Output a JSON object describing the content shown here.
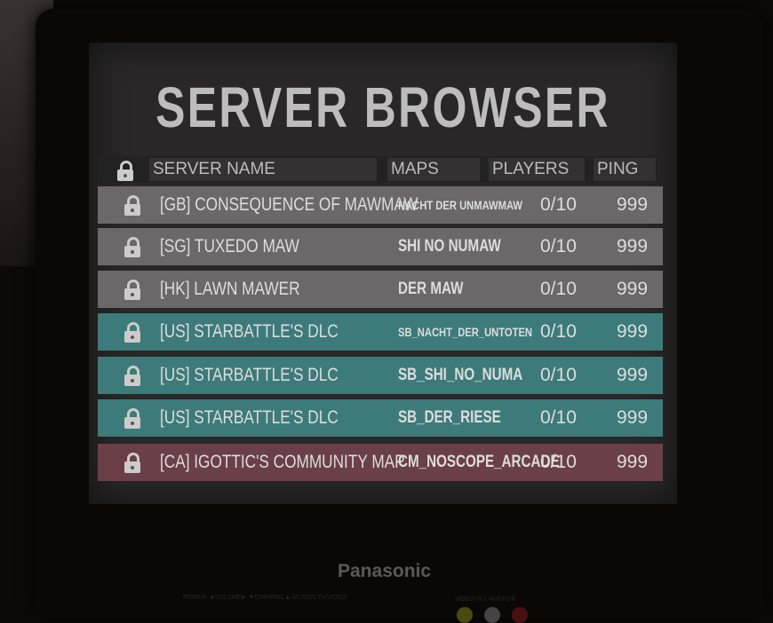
{
  "title": "SERVER BROWSER",
  "columns": {
    "server_name": "SERVER NAME",
    "maps": "MAPS",
    "players": "PLAYERS",
    "ping": "PING"
  },
  "colors": {
    "official": "#6a6868",
    "dlc": "#3d7b7a",
    "community": "#6b3f48"
  },
  "servers": [
    {
      "name": "[GB] CONSEQUENCE OF MAWMAW",
      "map": "NACHT DER UNMAWMAW",
      "players": "0/10",
      "ping": "999",
      "type": "official"
    },
    {
      "name": "[SG] TUXEDO MAW",
      "map": "SHI NO NUMAW",
      "players": "0/10",
      "ping": "999",
      "type": "official"
    },
    {
      "name": "[HK] LAWN MAWER",
      "map": "DER MAW",
      "players": "0/10",
      "ping": "999",
      "type": "official"
    },
    {
      "name": "[US] STARBATTLE'S DLC",
      "map": "SB_NACHT_DER_UNTOTEN",
      "players": "0/10",
      "ping": "999",
      "type": "dlc"
    },
    {
      "name": "[US] STARBATTLE'S DLC",
      "map": "SB_SHI_NO_NUMA",
      "players": "0/10",
      "ping": "999",
      "type": "dlc"
    },
    {
      "name": "[US] STARBATTLE'S DLC",
      "map": "SB_DER_RIESE",
      "players": "0/10",
      "ping": "999",
      "type": "dlc"
    },
    {
      "name": "[CA] IGOTTIC'S COMMUNITY MAP",
      "map": "CM_NOSCOPE_ARCADE",
      "players": "0/10",
      "ping": "999",
      "type": "community"
    }
  ],
  "tv": {
    "brand": "Panasonic",
    "controls": "POWER  ◄VOLUME►  ▼CHANNEL▲   ACTION  TV/VIDEO",
    "av_label": "VIDEO IN   L-AUDIO-R"
  }
}
